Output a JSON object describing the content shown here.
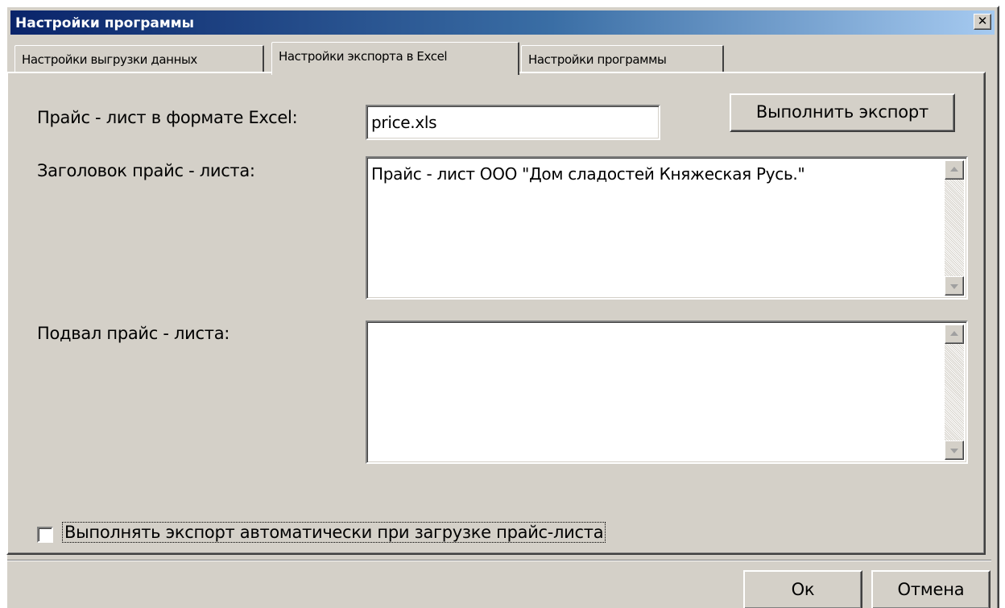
{
  "window": {
    "title": "Настройки программы",
    "close_glyph": "✕"
  },
  "tabs": [
    {
      "label": "Настройки выгрузки данных",
      "active": false
    },
    {
      "label": "Настройки экспорта в Excel",
      "active": true
    },
    {
      "label": "Настройки программы",
      "active": false
    }
  ],
  "export": {
    "price_file_label": "Прайс - лист в формате Excel:",
    "price_file_value": "price.xls",
    "run_export_label": "Выполнить экспорт",
    "header_label": "Заголовок прайс - листа:",
    "header_value": "Прайс - лист ООО \"Дом сладостей Княжеская Русь.\"",
    "footer_label": "Подвал прайс - листа:",
    "footer_value": "",
    "auto_export_label": "Выполнять экспорт автоматически при загрузке прайс-листа",
    "auto_export_checked": false
  },
  "footer": {
    "ok_label": "Ок",
    "cancel_label": "Отмена"
  },
  "colors": {
    "face": "#d4d0c8",
    "title_start": "#0a246a",
    "title_end": "#a6caf0"
  }
}
